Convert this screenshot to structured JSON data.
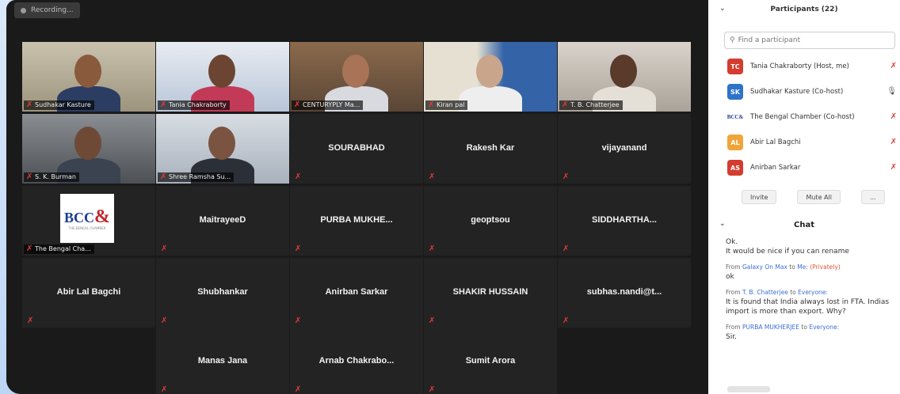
{
  "recording": {
    "label": "Recording..."
  },
  "participants_panel": {
    "title": "Participants (22)",
    "search_placeholder": "Find a participant",
    "list": [
      {
        "initials": "TC",
        "name": "Tania Chakraborty (Host, me)",
        "color": "#d43c2f"
      },
      {
        "initials": "SK",
        "name": "Sudhakar Kasture (Co-host)",
        "color": "#2d73c9"
      },
      {
        "initials": "BCC&",
        "name": "The Bengal Chamber (Co-host)",
        "color": "#ffffff"
      },
      {
        "initials": "AL",
        "name": "Abir Lal Bagchi",
        "color": "#f0a53a"
      },
      {
        "initials": "AS",
        "name": "Anirban Sarkar",
        "color": "#d43c2f"
      }
    ],
    "invite_label": "Invite",
    "mute_all_label": "Mute All",
    "more_label": "..."
  },
  "chat": {
    "title": "Chat",
    "messages": [
      {
        "from": "",
        "to": "",
        "text": "Ok.",
        "private": ""
      },
      {
        "from": "",
        "to": "",
        "text": "It would be nice if you can rename",
        "private": ""
      },
      {
        "from": "Galaxy On Max",
        "to": "Me",
        "text": "ok",
        "private": "(Privately)"
      },
      {
        "from": "T. B. Chatterjee",
        "to": "Everyone",
        "text": "It is found that India always lost in FTA. Indias import is more than export. Why?",
        "private": ""
      },
      {
        "from": "PURBA MUKHERJEE",
        "to": "Everyone",
        "text": "Sir.",
        "private": ""
      }
    ]
  },
  "tiles": [
    {
      "name": "Sudhakar Kasture",
      "type": "video",
      "active": true
    },
    {
      "name": "Tania Chakraborty",
      "type": "video"
    },
    {
      "name": "CENTURYPLY Ma...",
      "type": "video"
    },
    {
      "name": "Kiran pal",
      "type": "video"
    },
    {
      "name": "T. B. Chatterjee",
      "type": "video"
    },
    {
      "name": "S. K. Burman",
      "type": "video"
    },
    {
      "name": "Shree Ramsha Su...",
      "type": "video"
    },
    {
      "name": "SOURABHAD",
      "type": "name"
    },
    {
      "name": "Rakesh Kar",
      "type": "name"
    },
    {
      "name": "vijayanand",
      "type": "name"
    },
    {
      "name": "The Bengal Cha...",
      "type": "logo"
    },
    {
      "name": "MaitrayeeD",
      "type": "name"
    },
    {
      "name": "PURBA MUKHE...",
      "type": "name"
    },
    {
      "name": "geoptsou",
      "type": "name"
    },
    {
      "name": "SIDDHARTHA...",
      "type": "name"
    },
    {
      "name": "Abir Lal Bagchi",
      "type": "name"
    },
    {
      "name": "Shubhankar",
      "type": "name"
    },
    {
      "name": "Anirban Sarkar",
      "type": "name"
    },
    {
      "name": "SHAKIR HUSSAIN",
      "type": "name"
    },
    {
      "name": "subhas.nandi@t...",
      "type": "name"
    },
    {
      "name": "Manas Jana",
      "type": "name"
    },
    {
      "name": "Arnab Chakrabo...",
      "type": "name"
    },
    {
      "name": "Sumit Arora",
      "type": "name"
    }
  ],
  "logo": {
    "text": "BCC",
    "amp": "&",
    "sub": "THE BENGAL CHAMBER"
  },
  "colors": {
    "active_border": "#b8d94a",
    "muted_icon": "#e23a3a",
    "link": "#3b6fd6"
  }
}
